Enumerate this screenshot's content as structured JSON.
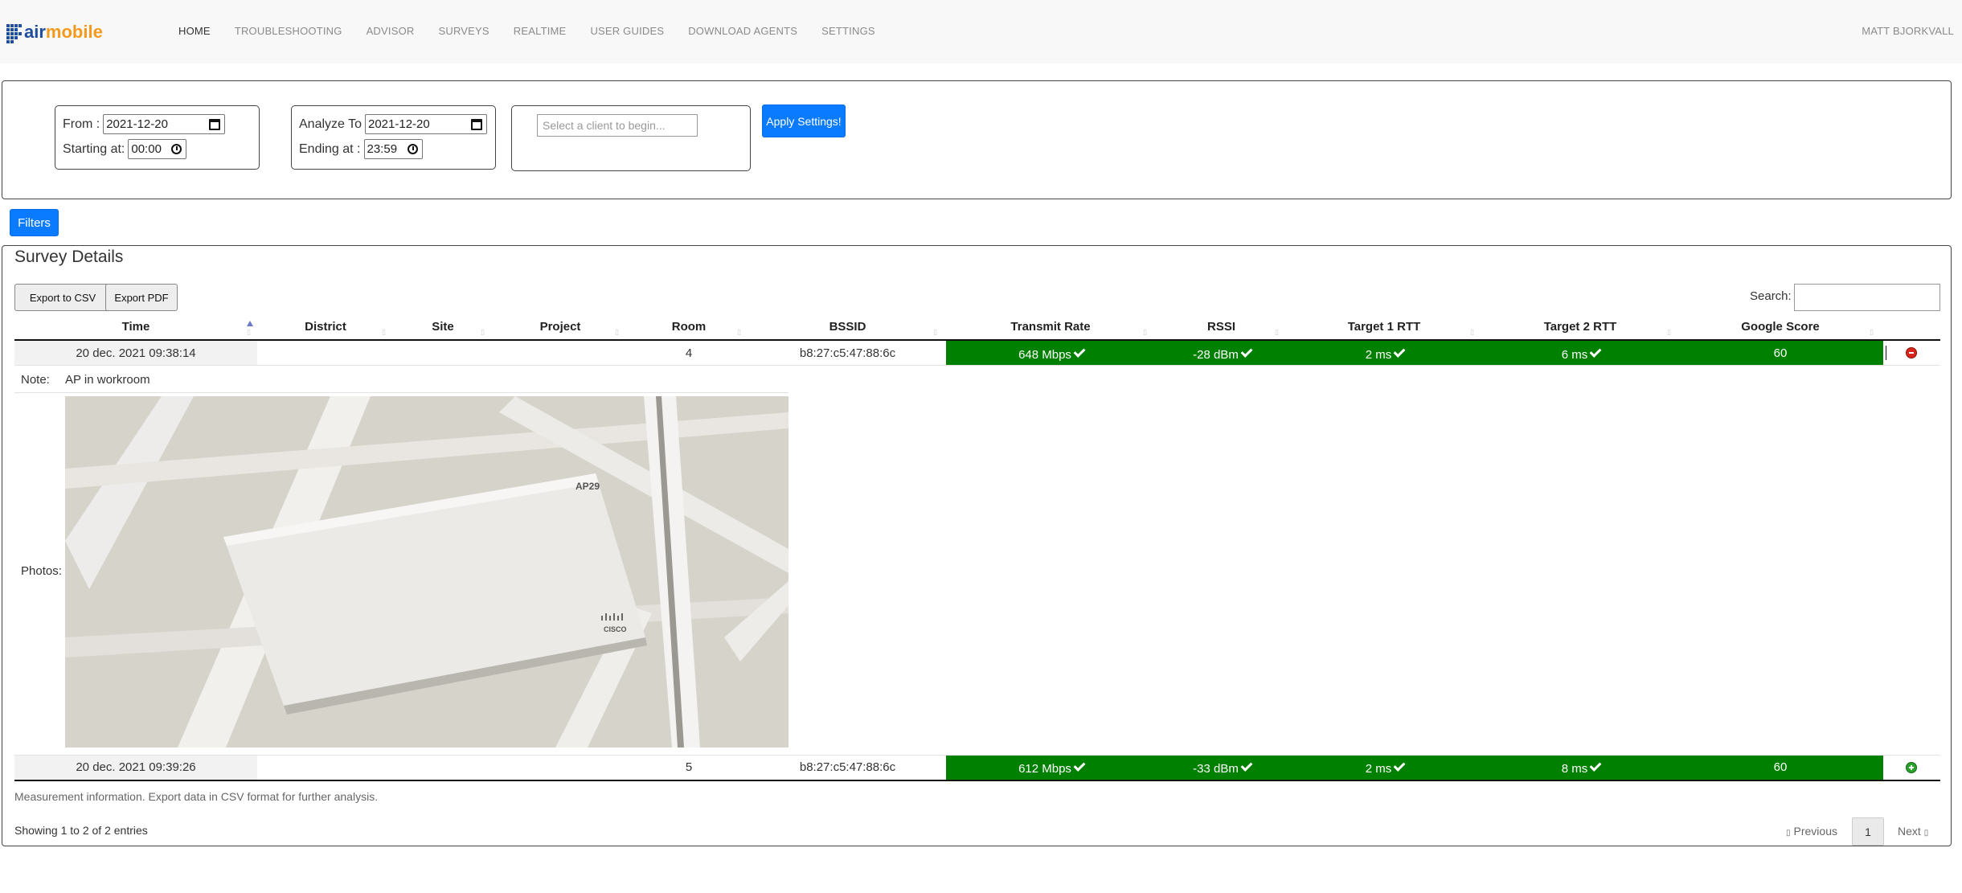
{
  "nav": {
    "brand": "airmobile",
    "items": [
      "HOME",
      "TROUBLESHOOTING",
      "ADVISOR",
      "SURVEYS",
      "REALTIME",
      "USER GUIDES",
      "DOWNLOAD AGENTS",
      "SETTINGS"
    ],
    "user": "MATT BJORKVALL"
  },
  "settings": {
    "from_label": "From :",
    "from_value": "2021-12-20",
    "starting_label": "Starting at:",
    "starting_value": "00:00",
    "analyze_label": "Analyze To",
    "analyze_value": "2021-12-20",
    "ending_label": "Ending at :",
    "ending_value": "23:59",
    "client_placeholder": "Select a client to begin...",
    "apply_label": "Apply Settings!",
    "filters_label": "Filters"
  },
  "survey": {
    "title": "Survey Details",
    "export_csv": "Export to CSV",
    "export_pdf": "Export PDF",
    "search_label": "Search:",
    "columns": [
      "Time",
      "District",
      "Site",
      "Project",
      "Room",
      "BSSID",
      "Transmit Rate",
      "RSSI",
      "Target 1 RTT",
      "Target 2 RTT",
      "Google Score"
    ],
    "rows": [
      {
        "time": "20 dec. 2021 09:38:14",
        "district": "",
        "site": "",
        "project": "",
        "room": "4",
        "bssid": "b8:27:c5:47:88:6c",
        "transmit_rate": "648 Mbps",
        "rssi": "-28 dBm",
        "target1": "2 ms",
        "target2": "6 ms",
        "google": "60",
        "toggle": "collapse"
      },
      {
        "time": "20 dec. 2021 09:39:26",
        "district": "",
        "site": "",
        "project": "",
        "room": "5",
        "bssid": "b8:27:c5:47:88:6c",
        "transmit_rate": "612 Mbps",
        "rssi": "-33 dBm",
        "target1": "2 ms",
        "target2": "8 ms",
        "google": "60",
        "toggle": "expand"
      }
    ],
    "detail": {
      "note_label": "Note:",
      "note_value": "AP in workroom",
      "photos_label": "Photos:",
      "photo_marking": "AP29",
      "photo_brand": "CISCO"
    },
    "footer_info": "Measurement information. Export data in CSV format for further analysis.",
    "entries_info": "Showing 1 to 2 of 2 entries",
    "pager": {
      "previous": "Previous",
      "page": "1",
      "next": "Next"
    },
    "status_color": "#008000"
  }
}
